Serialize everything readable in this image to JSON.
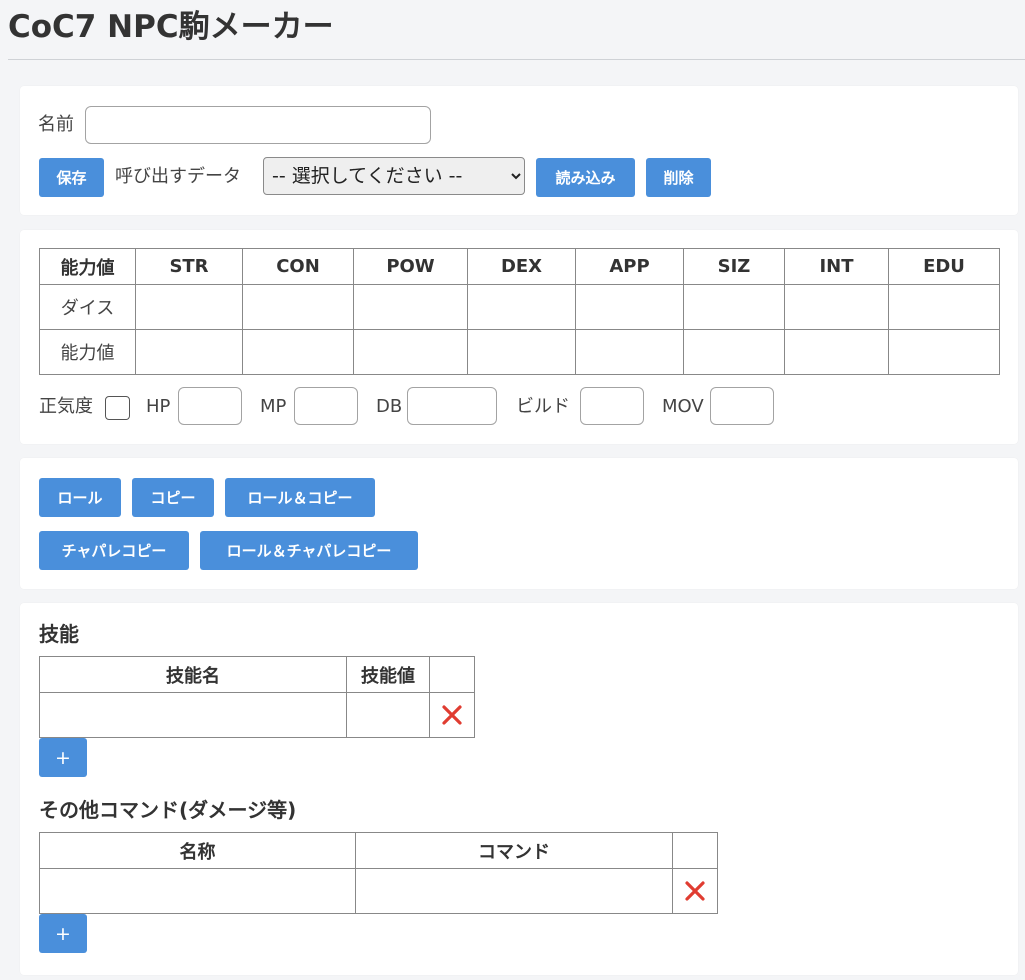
{
  "app": {
    "title": "CoC7 NPC駒メーカー"
  },
  "profile": {
    "name_label": "名前",
    "name_value": "",
    "save_label": "保存",
    "load_data_label": "呼び出すデータ",
    "select_selected": "-- 選択してください --",
    "load_label": "読み込み",
    "delete_label": "削除"
  },
  "stats": {
    "header_label": "能力値",
    "columns": [
      "STR",
      "CON",
      "POW",
      "DEX",
      "APP",
      "SIZ",
      "INT",
      "EDU"
    ],
    "row_dice_label": "ダイス",
    "row_value_label": "能力値",
    "sanity_label": "正気度",
    "hp_label": "HP",
    "mp_label": "MP",
    "db_label": "DB",
    "build_label": "ビルド",
    "mov_label": "MOV"
  },
  "actions": {
    "roll": "ロール",
    "copy": "コピー",
    "roll_copy": "ロール＆コピー",
    "chapare_copy": "チャパレコピー",
    "roll_chapare_copy": "ロール＆チャパレコピー"
  },
  "skills": {
    "title": "技能",
    "col_name": "技能名",
    "col_value": "技能値",
    "add_label": "+"
  },
  "commands": {
    "title": "その他コマンド(ダメージ等)",
    "col_name": "名称",
    "col_command": "コマンド",
    "add_label": "+"
  },
  "colors": {
    "accent": "#4a8fdb",
    "delete": "#e03c31",
    "background": "#f4f5f7"
  },
  "icons": {
    "delete": "close-icon"
  }
}
